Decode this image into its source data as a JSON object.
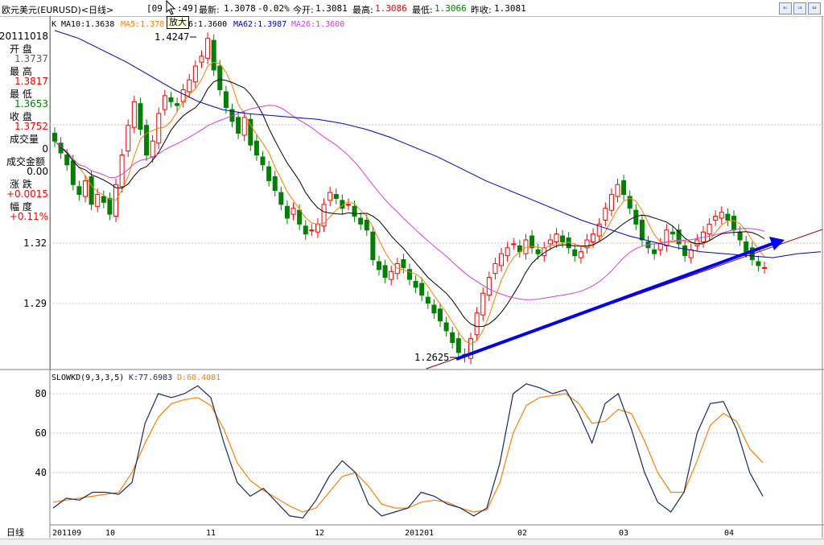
{
  "header": {
    "symbol": "欧元美元(EURUSD)<日线>",
    "time": "[09",
    "time2": ":49]",
    "latest_label": "最新:",
    "latest": "1.3078",
    "change": "-0.02%",
    "open_label": "今开:",
    "open": "1.3081",
    "high_label": "最高:",
    "high": "1.3086",
    "low_label": "最低:",
    "low": "1.3066",
    "prev_label": "昨收:",
    "prev": "1.3081"
  },
  "tooltip": "放大",
  "ma_legend": {
    "prefix": "K",
    "ma10": "MA10:1.3638",
    "ma5": "MA5:1.378",
    "ma20": "6:1.3600",
    "ma62": "MA62:1.3987",
    "ma26": "MA26:1.3600"
  },
  "side_panel": {
    "date": "20111018",
    "open_label": "开  盘",
    "open": "1.3737",
    "high_label": "最  高",
    "high": "1.3817",
    "low_label": "最  低",
    "low": "1.3653",
    "close_label": "收  盘",
    "close": "1.3752",
    "volume_label": "成交量",
    "volume": "0",
    "amount_label": "成交金额",
    "amount": "0.00",
    "change_label": "涨  跌",
    "change": "+0.0015",
    "pct_label": "幅  度",
    "pct": "+0.11%"
  },
  "colors": {
    "up": "#ff0000",
    "down": "#008000",
    "ma10": "#000000",
    "ma5": "#ff8000",
    "ma62": "#0000cc",
    "ma26": "#cc44cc",
    "k": "#1a2a5a",
    "d": "#ff8000",
    "trend": "#0000ff"
  },
  "kd_legend": {
    "name": "SLOWKD(9,3,3,5)",
    "k": "K:77.6983",
    "d": "D:60.4081"
  },
  "footer": {
    "period": "日线"
  },
  "chart_data": [
    {
      "type": "candlestick",
      "title": "欧元美元(EURUSD)<日线>",
      "y_ticks": [
        "1.32",
        "1.29"
      ],
      "ylim": [
        1.255,
        1.435
      ],
      "annotations": [
        {
          "label": "1.4247",
          "value": 1.4247
        },
        {
          "label": "1.2625",
          "value": 1.2625
        }
      ],
      "x_labels": [
        "201109",
        "10",
        "11",
        "12",
        "201201",
        "02",
        "03",
        "04"
      ],
      "close_series": [
        1.372,
        1.366,
        1.36,
        1.35,
        1.345,
        1.352,
        1.34,
        1.345,
        1.341,
        1.335,
        1.35,
        1.365,
        1.38,
        1.392,
        1.378,
        1.365,
        1.372,
        1.386,
        1.395,
        1.392,
        1.39,
        1.398,
        1.403,
        1.41,
        1.415,
        1.424,
        1.408,
        1.398,
        1.389,
        1.382,
        1.376,
        1.384,
        1.37,
        1.365,
        1.36,
        1.352,
        1.347,
        1.34,
        1.333,
        1.338,
        1.33,
        1.325,
        1.327,
        1.33,
        1.34,
        1.346,
        1.343,
        1.338,
        1.34,
        1.334,
        1.33,
        1.327,
        1.312,
        1.307,
        1.303,
        1.306,
        1.31,
        1.308,
        1.302,
        1.298,
        1.294,
        1.29,
        1.285,
        1.281,
        1.276,
        1.27,
        1.265,
        1.263,
        1.272,
        1.285,
        1.295,
        1.303,
        1.31,
        1.315,
        1.318,
        1.32,
        1.316,
        1.322,
        1.318,
        1.315,
        1.318,
        1.322,
        1.325,
        1.321,
        1.318,
        1.314,
        1.316,
        1.322,
        1.325,
        1.33,
        1.338,
        1.345,
        1.35,
        1.345,
        1.338,
        1.33,
        1.322,
        1.318,
        1.315,
        1.32,
        1.327,
        1.325,
        1.32,
        1.314,
        1.317,
        1.322,
        1.326,
        1.33,
        1.334,
        1.336,
        1.332,
        1.327,
        1.322,
        1.316,
        1.312,
        1.309,
        1.308
      ],
      "ma62_approx": [
        1.428,
        1.424,
        1.418,
        1.412,
        1.405,
        1.398,
        1.392,
        1.388,
        1.386,
        1.385,
        1.384,
        1.383,
        1.381,
        1.378,
        1.374,
        1.369,
        1.364,
        1.358,
        1.352,
        1.347,
        1.342,
        1.337,
        1.332,
        1.328,
        1.324,
        1.321,
        1.318,
        1.316,
        1.315,
        1.314,
        1.313,
        1.315,
        1.316
      ],
      "trendline": [
        {
          "label": "start",
          "value": 1.2625
        },
        {
          "label": "end",
          "value": 1.32
        }
      ]
    },
    {
      "type": "line",
      "title": "SLOWKD(9,3,3,5)",
      "y_ticks": [
        "80",
        "60",
        "40"
      ],
      "ylim": [
        15,
        92
      ],
      "series": [
        {
          "name": "K",
          "values": [
            22,
            27,
            26,
            30,
            30,
            29,
            35,
            65,
            80,
            78,
            80,
            84,
            78,
            55,
            35,
            28,
            32,
            25,
            18,
            17,
            26,
            38,
            46,
            40,
            24,
            18,
            20,
            22,
            30,
            28,
            24,
            22,
            18,
            22,
            45,
            80,
            85,
            83,
            80,
            82,
            70,
            55,
            75,
            80,
            62,
            40,
            25,
            20,
            30,
            60,
            75,
            76,
            62,
            40,
            28
          ]
        },
        {
          "name": "D",
          "values": [
            25,
            26,
            27,
            28,
            29,
            30,
            40,
            55,
            68,
            75,
            77,
            78,
            74,
            62,
            45,
            36,
            31,
            27,
            23,
            20,
            22,
            30,
            38,
            40,
            33,
            24,
            22,
            22,
            25,
            26,
            25,
            22,
            20,
            21,
            35,
            60,
            74,
            78,
            79,
            80,
            75,
            65,
            66,
            72,
            70,
            56,
            40,
            30,
            30,
            46,
            64,
            70,
            66,
            52,
            45
          ]
        }
      ]
    }
  ]
}
